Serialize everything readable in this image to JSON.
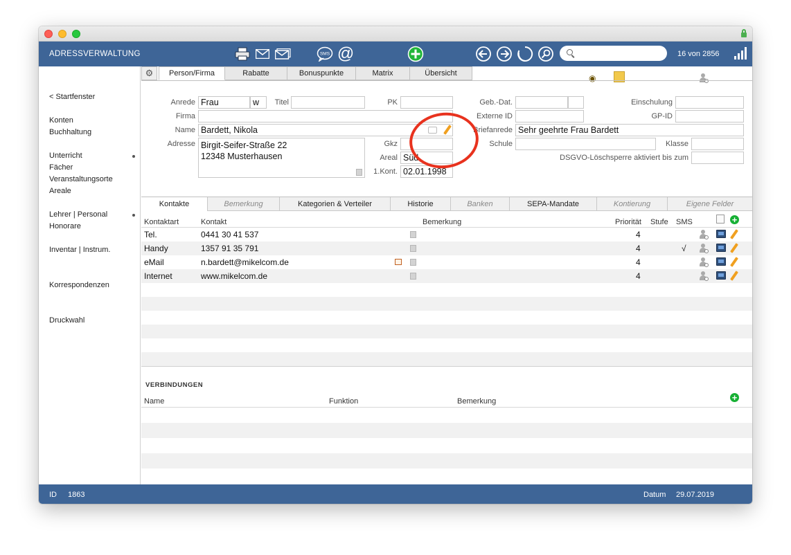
{
  "app": {
    "title": "ADRESSVERWALTUNG",
    "record_count": "16 von 2856",
    "search_placeholder": ""
  },
  "toolbar": {
    "sms_label": "SMS",
    "at_label": "@"
  },
  "sidebar": {
    "items": [
      "< Startfenster",
      "Konten",
      "Buchhaltung",
      "Unterricht",
      "Fächer",
      "Veranstaltungsorte",
      "Areale",
      "Lehrer | Personal",
      "Honorare",
      "Inventar | Instrum.",
      "Korrespondenzen",
      "Druckwahl"
    ]
  },
  "tabs": [
    "Person/Firma",
    "Rabatte",
    "Bonuspunkte",
    "Matrix",
    "Übersicht"
  ],
  "form": {
    "anrede_label": "Anrede",
    "anrede_value": "Frau",
    "gender_value": "w",
    "titel_label": "Titel",
    "titel_value": "",
    "pk_label": "PK",
    "pk_value": "",
    "firma_label": "Firma",
    "firma_value": "",
    "name_label": "Name",
    "name_value": "Bardett, Nikola",
    "adresse_label": "Adresse",
    "adresse_value": "Birgit-Seifer-Straße 22\n12348 Musterhausen",
    "gkz_label": "Gkz",
    "gkz_value": "",
    "areal_label": "Areal",
    "areal_value": "Süd",
    "kont_label": "1.Kont.",
    "kont_value": "02.01.1998",
    "gebdat_label": "Geb.-Dat.",
    "gebdat_value": "",
    "externe_label": "Externe ID",
    "externe_value": "",
    "briefanrede_label": "Briefanrede",
    "briefanrede_value": "Sehr geehrte Frau Bardett",
    "schule_label": "Schule",
    "schule_value": "",
    "einschulung_label": "Einschulung",
    "einschulung_value": "",
    "gpid_label": "GP-ID",
    "gpid_value": "",
    "klasse_label": "Klasse",
    "klasse_value": "",
    "dsgvo_label": "DSGVO-Löschsperre aktiviert bis zum",
    "dsgvo_value": ""
  },
  "subtabs": [
    "Kontakte",
    "Bemerkung",
    "Kategorien & Verteiler",
    "Historie",
    "Banken",
    "SEPA-Mandate",
    "Kontierung",
    "Eigene Felder"
  ],
  "contacts": {
    "headers": {
      "kontaktart": "Kontaktart",
      "kontakt": "Kontakt",
      "bemerkung": "Bemerkung",
      "prioritaet": "Priorität",
      "stufe": "Stufe",
      "sms": "SMS"
    },
    "rows": [
      {
        "art": "Tel.",
        "kontakt": "0441 30 41 537",
        "prio": "4",
        "sms": ""
      },
      {
        "art": "Handy",
        "kontakt": "1357 91 35 791",
        "prio": "4",
        "sms": "√"
      },
      {
        "art": "eMail",
        "kontakt": "n.bardett@mikelcom.de",
        "prio": "4",
        "sms": ""
      },
      {
        "art": "Internet",
        "kontakt": "www.mikelcom.de",
        "prio": "4",
        "sms": ""
      }
    ]
  },
  "verbindungen": {
    "title": "VERBINDUNGEN",
    "headers": {
      "name": "Name",
      "funktion": "Funktion",
      "bemerkung": "Bemerkung"
    }
  },
  "status": {
    "id_label": "ID",
    "id_value": "1863",
    "datum_label": "Datum",
    "datum_value": "29.07.2019"
  }
}
